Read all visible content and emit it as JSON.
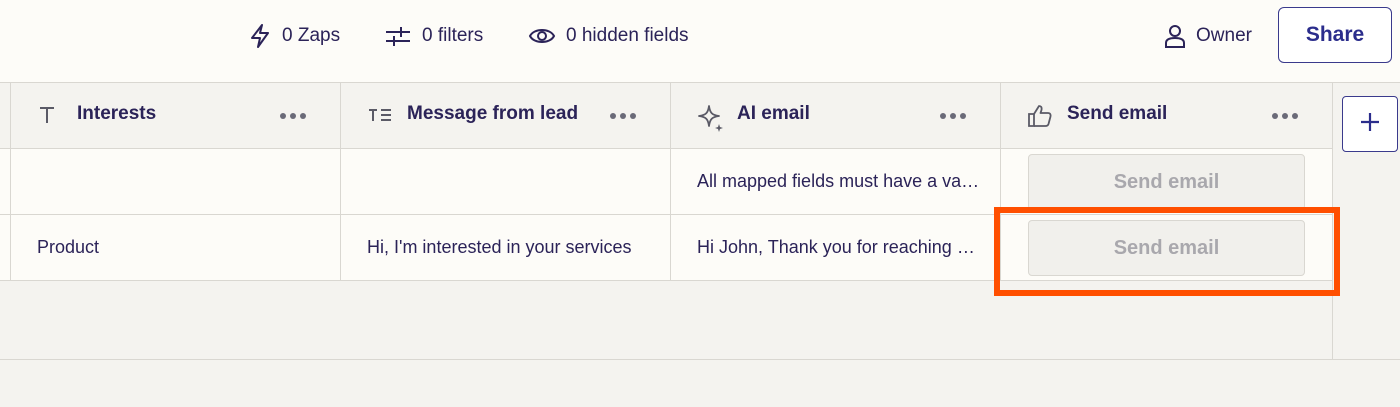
{
  "toolbar": {
    "zaps": "0 Zaps",
    "filters": "0 filters",
    "hidden_fields": "0 hidden fields",
    "owner": "Owner",
    "share": "Share"
  },
  "columns": [
    {
      "label": "Interests",
      "icon": "text-icon"
    },
    {
      "label": "Message from lead",
      "icon": "long-text-icon"
    },
    {
      "label": "AI email",
      "icon": "ai-sparkle-icon"
    },
    {
      "label": "Send email",
      "icon": "thumbs-up-icon"
    }
  ],
  "rows": [
    {
      "interests": "",
      "message": "",
      "ai_email": "All mapped fields must have a value",
      "send_email": "Send email"
    },
    {
      "interests": "Product",
      "message": "Hi, I'm interested in your services",
      "ai_email": "Hi John, Thank you for reaching out",
      "send_email": "Send email"
    }
  ],
  "colors": {
    "accent": "#2b2d8c",
    "highlight": "#ff4f00",
    "header_bg": "#f4f3ef",
    "row_bg": "#fdfcf8"
  }
}
